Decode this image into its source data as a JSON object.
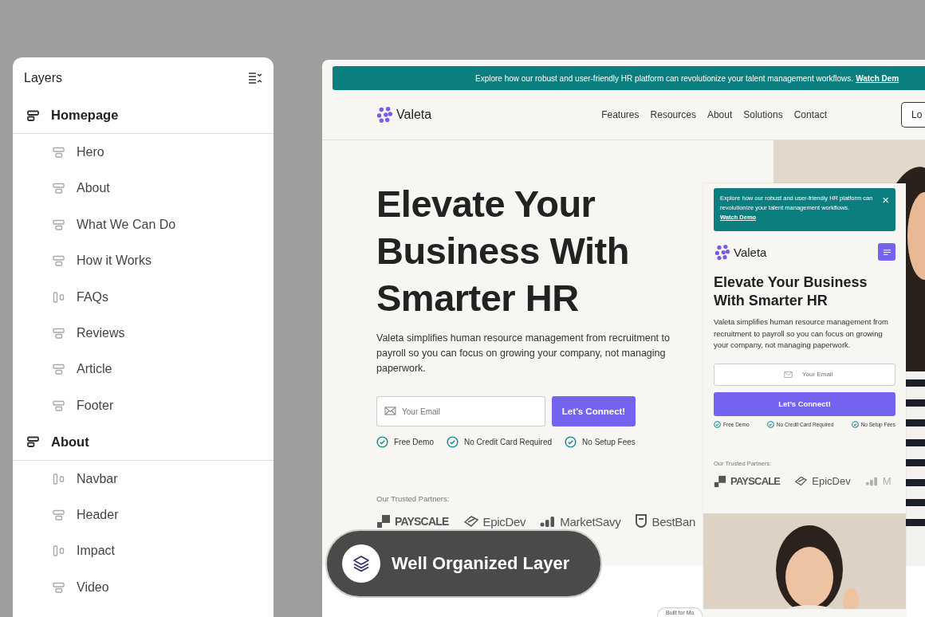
{
  "layers_panel": {
    "title": "Layers",
    "groups": [
      {
        "label": "Homepage",
        "kind": "stack",
        "children": [
          {
            "label": "Hero",
            "kind": "stack"
          },
          {
            "label": "About",
            "kind": "stack"
          },
          {
            "label": "What We Can Do",
            "kind": "stack"
          },
          {
            "label": "How it Works",
            "kind": "stack"
          },
          {
            "label": "FAQs",
            "kind": "columns"
          },
          {
            "label": "Reviews",
            "kind": "stack"
          },
          {
            "label": "Article",
            "kind": "stack"
          },
          {
            "label": "Footer",
            "kind": "stack"
          }
        ]
      },
      {
        "label": "About",
        "kind": "stack",
        "children": [
          {
            "label": "Navbar",
            "kind": "columns"
          },
          {
            "label": "Header",
            "kind": "stack"
          },
          {
            "label": "Impact",
            "kind": "columns"
          },
          {
            "label": "Video",
            "kind": "stack"
          }
        ]
      }
    ]
  },
  "website": {
    "banner": {
      "text": "Explore how our robust and user-friendly HR platform can revolutionize your talent management workflows.",
      "link": "Watch Dem"
    },
    "nav": {
      "brand": "Valeta",
      "links": [
        "Features",
        "Resources",
        "About",
        "Solutions",
        "Contact"
      ],
      "button": "Lo"
    },
    "hero": {
      "title": "Elevate Your Business With Smarter HR",
      "description": "Valeta simplifies human resource management from recruitment to payroll so you can focus on growing your company, not managing paperwork.",
      "email_placeholder": "Your Email",
      "button": "Let’s Connect!",
      "checks": [
        "Free Demo",
        "No Credit Card Required",
        "No Setup Fees"
      ],
      "partners_label": "Our Trusted Partners:",
      "partners": [
        {
          "name": "PAYSCALE",
          "kind": "squares"
        },
        {
          "name": "EpicDev",
          "kind": "arrows"
        },
        {
          "name": "MarketSavy",
          "kind": "bars"
        },
        {
          "name": "BestBan",
          "kind": "shield"
        }
      ]
    },
    "mobile_preview": {
      "banner": {
        "text": "Explore how our robust and user-friendly HR platform can revolutionize your talent management workflows.",
        "link": "Watch Demo",
        "close": "×"
      },
      "brand": "Valeta",
      "title": "Elevate Your Business With Smarter HR",
      "description": "Valeta simplifies human resource management from recruitment to payroll so you can focus on growing your company, not managing paperwork.",
      "email_placeholder": "Your Email",
      "button": "Let’s Connect!",
      "checks": [
        "Free Demo",
        "No Credit Card Required",
        "No Setup Fees"
      ],
      "partners_label": "Our Trusted Partners:",
      "partners": [
        {
          "name": "PAYSCALE",
          "kind": "squares"
        },
        {
          "name": "EpicDev",
          "kind": "arrows"
        },
        {
          "name": "M",
          "kind": "bars"
        }
      ]
    },
    "footer_pill": "Built for Mo"
  },
  "badge": {
    "label": "Well Organized Layer"
  }
}
